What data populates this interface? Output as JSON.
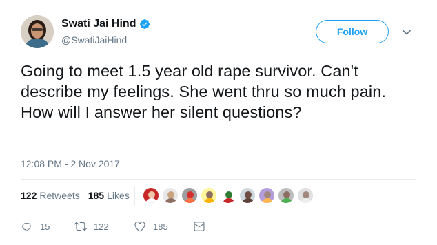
{
  "user": {
    "name": "Swati Jai Hind",
    "handle": "@SwatiJaiHind",
    "verified": true
  },
  "follow_label": "Follow",
  "tweet": {
    "text": "Going to meet 1.5 year old rape survivor. Can't describe my feelings. She went thru so much pain. How will I answer her silent questions?",
    "timestamp": "12:08 PM - 2 Nov 2017"
  },
  "stats": {
    "retweets_count": "122",
    "retweets_label": "Retweets",
    "likes_count": "185",
    "likes_label": "Likes"
  },
  "likers": [
    {
      "bg": "#c62828",
      "face": "#f1c6a8",
      "body": "#ffffff"
    },
    {
      "bg": "#e8e8e8",
      "face": "#c9a27e",
      "body": "#8d6e63"
    },
    {
      "bg": "#9e9e9e",
      "face": "#d32f2f",
      "body": "#ff7043"
    },
    {
      "bg": "#fff59d",
      "face": "#8d6e63",
      "body": "#ffb300"
    },
    {
      "bg": "#ffffff",
      "face": "#2e7d32",
      "body": "#c62828"
    },
    {
      "bg": "#cfd8dc",
      "face": "#6d4c41",
      "body": "#5d4037"
    },
    {
      "bg": "#b39ddb",
      "face": "#a1887f",
      "body": "#ffb74d"
    },
    {
      "bg": "#bdbdbd",
      "face": "#8d6e63",
      "body": "#4caf50"
    },
    {
      "bg": "#e0e0e0",
      "face": "#a1887f",
      "body": "#eeeeee"
    }
  ],
  "actions": {
    "replies": "15",
    "retweets": "122",
    "likes": "185"
  },
  "colors": {
    "accent": "#1da1f2",
    "text": "#14171a",
    "muted": "#657786",
    "border": "#e6ecf0"
  },
  "icons": [
    "verified-badge-icon",
    "chevron-down-icon",
    "reply-icon",
    "retweet-icon",
    "heart-icon",
    "message-icon"
  ]
}
